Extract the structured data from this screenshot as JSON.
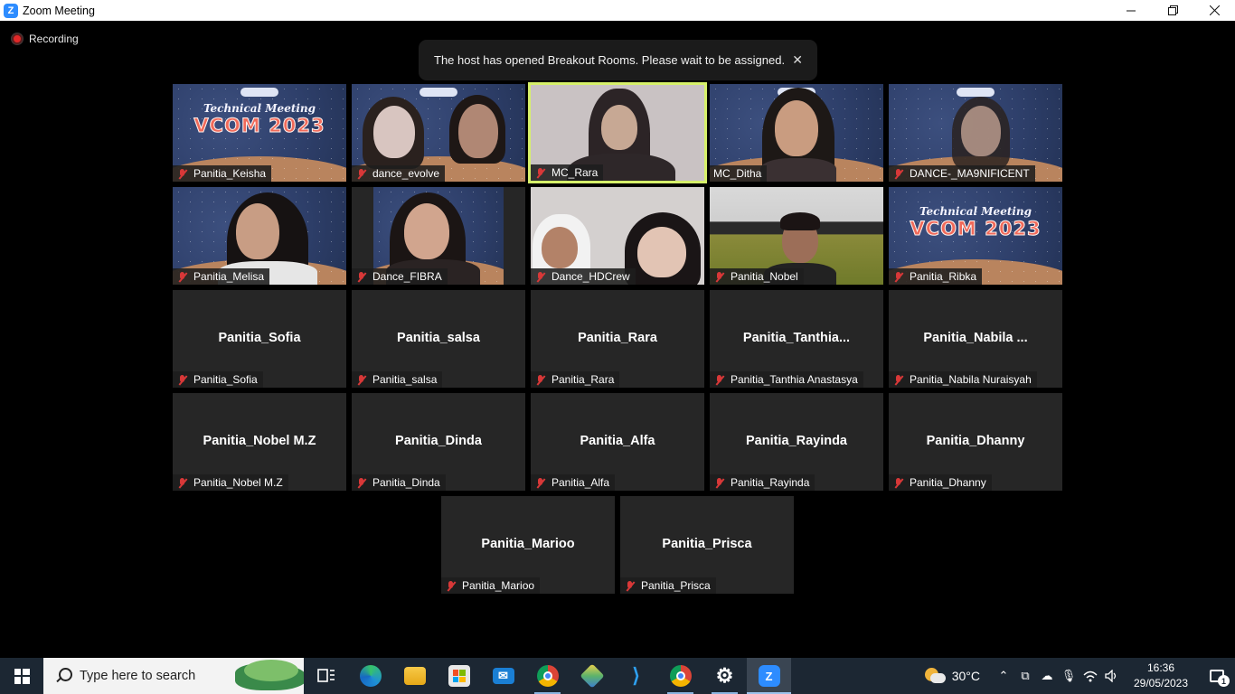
{
  "window": {
    "title": "Zoom Meeting",
    "app_icon": "zoom-icon",
    "controls": [
      "minimize-icon",
      "restore-icon",
      "close-icon"
    ]
  },
  "meeting": {
    "recording_label": "Recording",
    "notification": "The host has opened Breakout Rooms. Please wait to be assigned.",
    "notification_close_icon": "close-icon",
    "active_speaker": "MC_Rara",
    "active_border_color": "#d6f06a",
    "muted_icon": "mic-muted-icon",
    "banner_text": {
      "line1": "Technical Meeting",
      "line2": "VCOM 2023"
    },
    "video_tiles": [
      {
        "label": "Panitia_Keisha",
        "muted": true,
        "video": "banner"
      },
      {
        "label": "dance_evolve",
        "muted": true,
        "video": "camera"
      },
      {
        "label": "MC_Rara",
        "muted": true,
        "video": "camera",
        "active": true
      },
      {
        "label": "MC_Ditha",
        "muted": false,
        "video": "camera"
      },
      {
        "label": "DANCE-_MA9NIFICENT",
        "muted": true,
        "video": "camera"
      },
      {
        "label": "Panitia_Melisa",
        "muted": true,
        "video": "camera"
      },
      {
        "label": "Dance_FIBRA",
        "muted": true,
        "video": "camera"
      },
      {
        "label": "Dance_HDCrew",
        "muted": true,
        "video": "camera"
      },
      {
        "label": "Panitia_Nobel",
        "muted": true,
        "video": "camera"
      },
      {
        "label": "Panitia_Ribka",
        "muted": true,
        "video": "banner"
      }
    ],
    "name_tiles": [
      {
        "display": "Panitia_Sofia",
        "label": "Panitia_Sofia"
      },
      {
        "display": "Panitia_salsa",
        "label": "Panitia_salsa"
      },
      {
        "display": "Panitia_Rara",
        "label": "Panitia_Rara"
      },
      {
        "display": "Panitia_Tanthia...",
        "label": "Panitia_Tanthia Anastasya"
      },
      {
        "display": "Panitia_Nabila ...",
        "label": "Panitia_Nabila Nuraisyah"
      },
      {
        "display": "Panitia_Nobel M.Z",
        "label": "Panitia_Nobel M.Z"
      },
      {
        "display": "Panitia_Dinda",
        "label": "Panitia_Dinda"
      },
      {
        "display": "Panitia_Alfa",
        "label": "Panitia_Alfa"
      },
      {
        "display": "Panitia_Rayinda",
        "label": "Panitia_Rayinda"
      },
      {
        "display": "Panitia_Dhanny",
        "label": "Panitia_Dhanny"
      },
      {
        "display": "Panitia_Marioo",
        "label": "Panitia_Marioo"
      },
      {
        "display": "Panitia_Prisca",
        "label": "Panitia_Prisca"
      }
    ]
  },
  "taskbar": {
    "search_placeholder": "Type here to search",
    "apps": [
      {
        "name": "task-view-icon"
      },
      {
        "name": "edge-icon"
      },
      {
        "name": "file-explorer-icon"
      },
      {
        "name": "microsoft-store-icon"
      },
      {
        "name": "mail-icon"
      },
      {
        "name": "chrome-icon"
      },
      {
        "name": "3d-viewer-icon"
      },
      {
        "name": "vscode-icon"
      },
      {
        "name": "chrome-profile-icon"
      },
      {
        "name": "settings-icon"
      },
      {
        "name": "zoom-icon"
      }
    ],
    "weather": "30°C",
    "time": "16:36",
    "date": "29/05/2023",
    "notification_count": "1"
  }
}
